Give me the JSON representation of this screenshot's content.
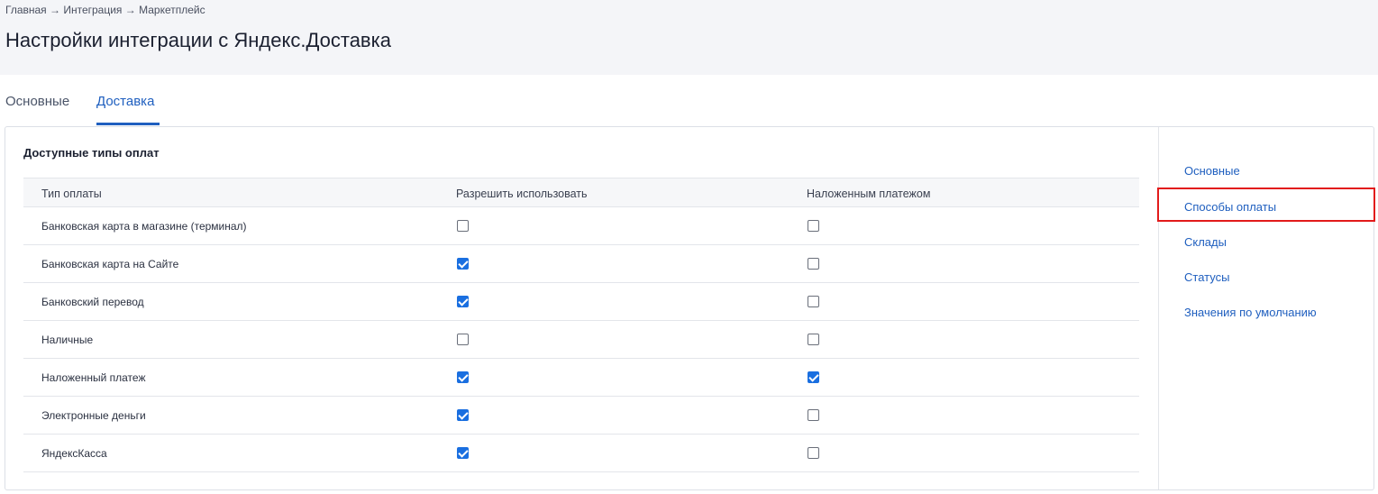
{
  "breadcrumb": "Главная → Интеграция → Маркетплейс",
  "page_title": "Настройки интеграции с Яндекс.Доставка",
  "tabs": [
    {
      "label": "Основные",
      "active": false
    },
    {
      "label": "Доставка",
      "active": true
    }
  ],
  "section": {
    "title": "Доступные типы оплат",
    "columns": [
      "Тип оплаты",
      "Разрешить использовать",
      "Наложенным платежом"
    ],
    "rows": [
      {
        "label": "Банковская карта в магазине (терминал)",
        "allow": false,
        "cod": false
      },
      {
        "label": "Банковская карта на Сайте",
        "allow": true,
        "cod": false
      },
      {
        "label": "Банковский перевод",
        "allow": true,
        "cod": false
      },
      {
        "label": "Наличные",
        "allow": false,
        "cod": false
      },
      {
        "label": "Наложенный платеж",
        "allow": true,
        "cod": true
      },
      {
        "label": "Электронные деньги",
        "allow": true,
        "cod": false
      },
      {
        "label": "ЯндексКасса",
        "allow": true,
        "cod": false
      }
    ]
  },
  "side_nav": {
    "items": [
      "Основные",
      "Способы оплаты",
      "Склады",
      "Статусы",
      "Значения по умолчанию"
    ],
    "highlighted_index": 1,
    "highlight_color": "#e21b1b"
  },
  "colors": {
    "accent": "#1f5fbf",
    "checkbox_checked": "#1a6fe0"
  }
}
